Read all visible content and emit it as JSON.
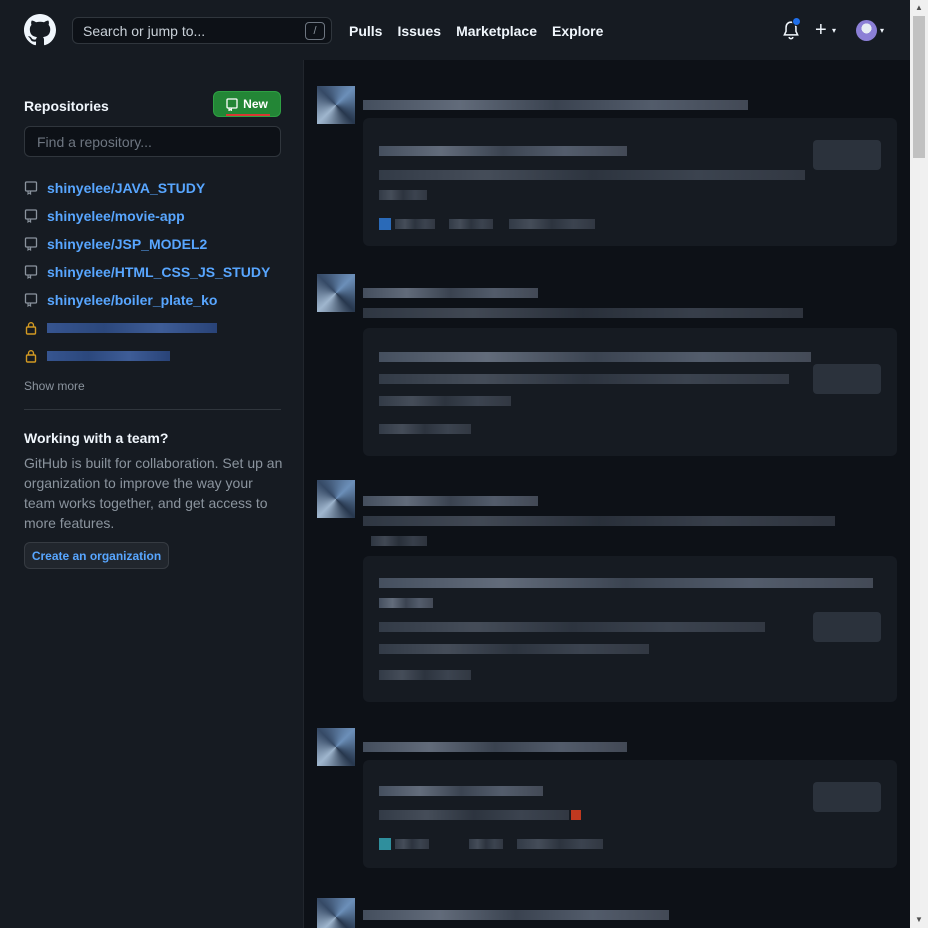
{
  "header": {
    "search_placeholder": "Search or jump to...",
    "search_shortcut": "/",
    "nav": [
      "Pulls",
      "Issues",
      "Marketplace",
      "Explore"
    ],
    "plus": "+",
    "caret": "▾"
  },
  "sidebar": {
    "repositories_heading": "Repositories",
    "new_button": "New",
    "find_placeholder": "Find a repository...",
    "repos": [
      {
        "name": "shinyelee/JAVA_STUDY",
        "private": false
      },
      {
        "name": "shinyelee/movie-app",
        "private": false
      },
      {
        "name": "shinyelee/JSP_MODEL2",
        "private": false
      },
      {
        "name": "shinyelee/HTML_CSS_JS_STUDY",
        "private": false
      },
      {
        "name": "shinyelee/boiler_plate_ko",
        "private": false
      }
    ],
    "show_more": "Show more",
    "team": {
      "title": "Working with a team?",
      "description": "GitHub is built for collaboration. Set up an organization to improve the way your team works together, and get access to more features.",
      "button": "Create an organization"
    }
  },
  "colors": {
    "header_bg": "#161b22",
    "page_bg": "#0d1117",
    "link": "#58a6ff",
    "new_button": "#238636",
    "lock": "#d29922"
  },
  "scrollbar": {
    "up": "▲",
    "down": "▼"
  }
}
